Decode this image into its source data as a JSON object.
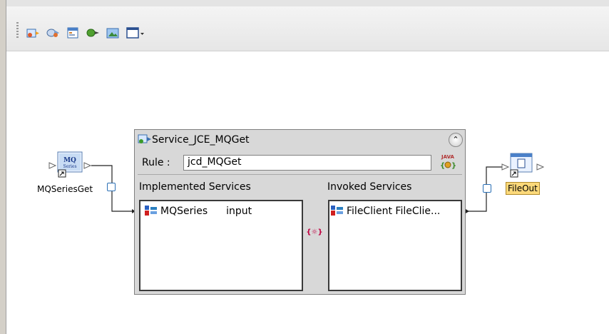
{
  "toolbar": {
    "buttons": [
      {
        "icon": "service-icon"
      },
      {
        "icon": "oneway-icon"
      },
      {
        "icon": "collaboration-icon"
      },
      {
        "icon": "connector-icon"
      },
      {
        "icon": "image-icon"
      },
      {
        "icon": "window-dropdown-icon"
      }
    ]
  },
  "components": {
    "mq": {
      "label": "MQSeriesGet",
      "icon_text_top": "MQ",
      "icon_text_bottom": "Series"
    },
    "file": {
      "label": "FileOut"
    }
  },
  "service": {
    "title": "Service_JCE_MQGet",
    "rule_label": "Rule :",
    "rule_value": "jcd_MQGet",
    "java_badge": "JAVA",
    "implemented_label": "Implemented Services",
    "invoked_label": "Invoked Services",
    "implemented_rows": [
      {
        "name": "MQSeries",
        "op": "input"
      }
    ],
    "invoked_rows": [
      {
        "name": "FileClient",
        "op": "FileClie..."
      }
    ]
  },
  "colors": {
    "port": "#2a6fb5",
    "file_label_bg": "#fcd97a",
    "service_bg": "#d8d8d8"
  }
}
